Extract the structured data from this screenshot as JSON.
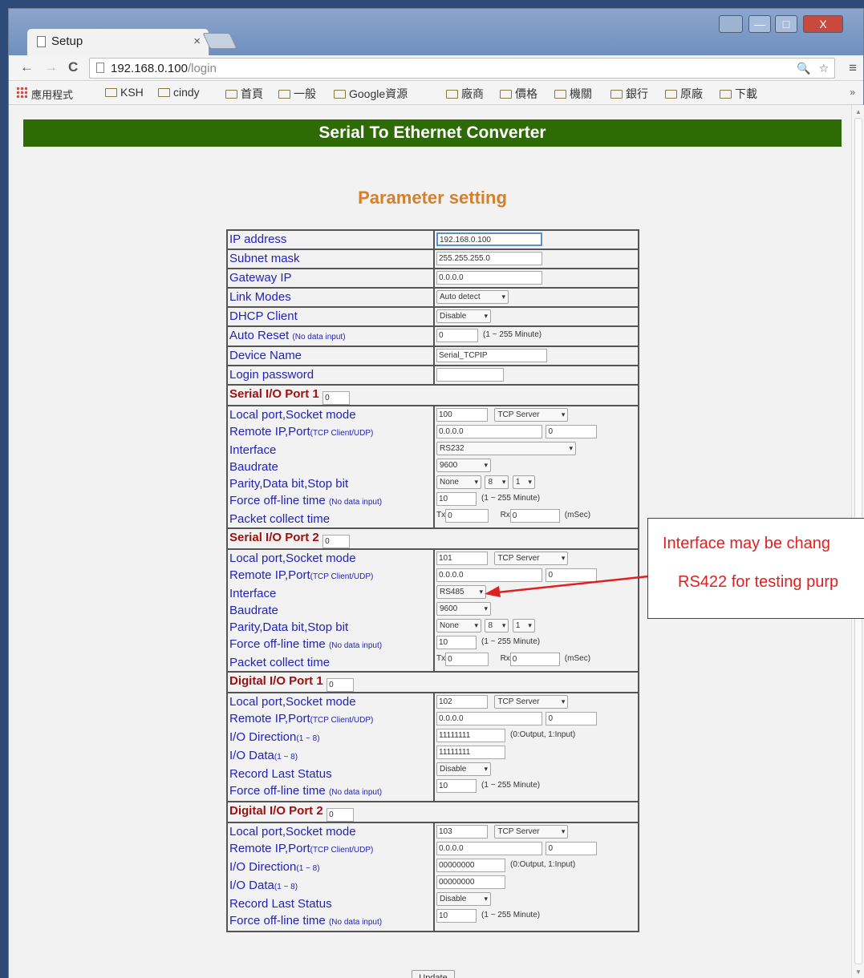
{
  "browser": {
    "tab_title": "Setup",
    "tab_close": "×",
    "url_host": "192.168.0.100",
    "url_path": "/login",
    "window_buttons": {
      "minimize": "—",
      "maximize": "□",
      "close": "X"
    },
    "bookmarks": [
      "KSH",
      "cindy",
      "首頁",
      "一般",
      "Google資源",
      "廠商",
      "價格",
      "機關",
      "銀行",
      "原廠",
      "下載"
    ],
    "apps_label": "應用程式",
    "bookmarks_more": "»"
  },
  "page": {
    "banner": "Serial To Ethernet Converter",
    "heading": "Parameter setting",
    "update_button": "Update"
  },
  "general": {
    "ip_label": "IP address",
    "ip_value": "192.168.0.100",
    "subnet_label": "Subnet mask",
    "subnet_value": "255.255.255.0",
    "gateway_label": "Gateway IP",
    "gateway_value": "0.0.0.0",
    "link_label": "Link Modes",
    "link_value": "Auto detect",
    "dhcp_label": "DHCP Client",
    "dhcp_value": "Disable",
    "autoreset_label": "Auto Reset",
    "autoreset_note": "(No data input)",
    "autoreset_value": "0",
    "autoreset_range": "(1 ~ 255 Minute)",
    "devname_label": "Device Name",
    "devname_value": "Serial_TCPIP",
    "login_label": "Login password"
  },
  "serial1": {
    "title": "Serial I/O Port 1",
    "title_box": "0",
    "local_label": "Local port,Socket mode",
    "local_port": "100",
    "socket_mode": "TCP Server",
    "remote_label": "Remote IP,Port",
    "remote_note": "(TCP Client/UDP)",
    "remote_ip": "0.0.0.0",
    "remote_port": "0",
    "interface_label": "Interface",
    "interface_value": "RS232",
    "baud_label": "Baudrate",
    "baud_value": "9600",
    "parity_label": "Parity,Data bit,Stop bit",
    "parity": "None",
    "data_bit": "8",
    "stop_bit": "1",
    "force_label": "Force off-line time",
    "force_note": "(No data input)",
    "force_value": "10",
    "force_range": "(1 ~ 255 Minute)",
    "packet_label": "Packet collect time",
    "tx_label": "Tx",
    "tx_value": "0",
    "rx_label": "Rx",
    "rx_value": "0",
    "unit": "(mSec)"
  },
  "serial2": {
    "title": "Serial I/O Port 2",
    "title_box": "0",
    "local_label": "Local port,Socket mode",
    "local_port": "101",
    "socket_mode": "TCP Server",
    "remote_label": "Remote IP,Port",
    "remote_note": "(TCP Client/UDP)",
    "remote_ip": "0.0.0.0",
    "remote_port": "0",
    "interface_label": "Interface",
    "interface_value": "RS485",
    "baud_label": "Baudrate",
    "baud_value": "9600",
    "parity_label": "Parity,Data bit,Stop bit",
    "parity": "None",
    "data_bit": "8",
    "stop_bit": "1",
    "force_label": "Force off-line time",
    "force_note": "(No data input)",
    "force_value": "10",
    "force_range": "(1 ~ 255 Minute)",
    "packet_label": "Packet collect time",
    "tx_label": "Tx",
    "tx_value": "0",
    "rx_label": "Rx",
    "rx_value": "0",
    "unit": "(mSec)"
  },
  "digital1": {
    "title": "Digital I/O Port 1",
    "title_box": "0",
    "local_label": "Local port,Socket mode",
    "local_port": "102",
    "socket_mode": "TCP Server",
    "remote_label": "Remote IP,Port",
    "remote_note": "(TCP Client/UDP)",
    "remote_ip": "0.0.0.0",
    "remote_port": "0",
    "dir_label": "I/O Direction",
    "dir_note": "(1 ~ 8)",
    "dir_value": "11111111",
    "dir_hint": "(0:Output, 1:Input)",
    "data_label": "I/O Data",
    "data_note": "(1 ~ 8)",
    "data_value": "11111111",
    "record_label": "Record Last Status",
    "record_value": "Disable",
    "force_label": "Force off-line time",
    "force_note": "(No data input)",
    "force_value": "10",
    "force_range": "(1 ~ 255 Minute)"
  },
  "digital2": {
    "title": "Digital I/O Port 2",
    "title_box": "0",
    "local_label": "Local port,Socket mode",
    "local_port": "103",
    "socket_mode": "TCP Server",
    "remote_label": "Remote IP,Port",
    "remote_note": "(TCP Client/UDP)",
    "remote_ip": "0.0.0.0",
    "remote_port": "0",
    "dir_label": "I/O Direction",
    "dir_note": "(1 ~ 8)",
    "dir_value": "00000000",
    "dir_hint": "(0:Output, 1:Input)",
    "data_label": "I/O Data",
    "data_note": "(1 ~ 8)",
    "data_value": "00000000",
    "record_label": "Record Last Status",
    "record_value": "Disable",
    "force_label": "Force off-line time",
    "force_note": "(No data input)",
    "force_value": "10",
    "force_range": "(1 ~ 255 Minute)"
  },
  "callout": {
    "line1": "Interface may be chang",
    "line2": "RS422 for testing purp"
  },
  "colors": {
    "banner_bg": "#2e6a06",
    "heading": "#d5802b",
    "label_blue": "#2323b8",
    "section_red": "#9b1010",
    "callout_red": "#e02020"
  }
}
